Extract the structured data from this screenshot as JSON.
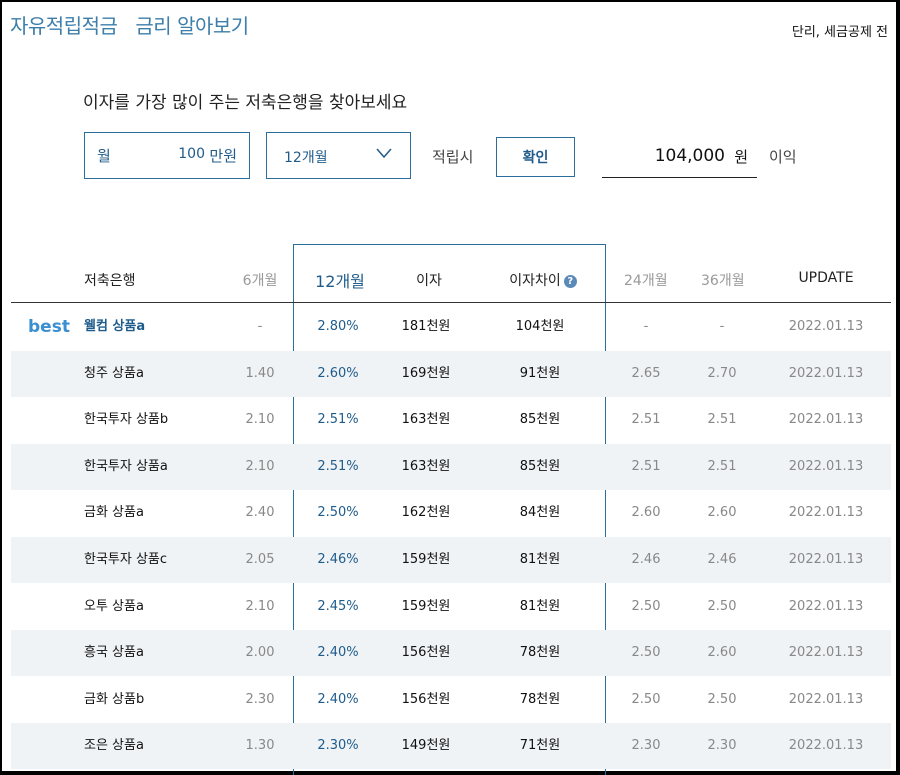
{
  "header": {
    "title": "자유적립적금",
    "subtitle": "금리 알아보기",
    "note": "단리, 세금공제 전"
  },
  "calculator": {
    "headline": "이자를 가장 많이 주는 저축은행을 찾아보세요",
    "monthly_label": "월",
    "monthly_amount": "100",
    "monthly_unit": "만원",
    "period_value": "12개월",
    "deposit_label": "적립시",
    "confirm_label": "확인",
    "result_amount": "104,000",
    "result_unit": "원",
    "interest_label": "이익"
  },
  "table": {
    "columns": {
      "bank": "저축은행",
      "m6": "6개월",
      "m12": "12개월",
      "interest": "이자",
      "diff": "이자차이",
      "m24": "24개월",
      "m36": "36개월",
      "update": "UPDATE"
    },
    "best_badge": "best",
    "rows": [
      {
        "bank": "웰컴 상품a",
        "m6": "-",
        "m12": "2.80%",
        "interest": "181천원",
        "diff": "104천원",
        "m24": "-",
        "m36": "-",
        "update": "2022.01.13"
      },
      {
        "bank": "청주 상품a",
        "m6": "1.40",
        "m12": "2.60%",
        "interest": "169천원",
        "diff": "91천원",
        "m24": "2.65",
        "m36": "2.70",
        "update": "2022.01.13"
      },
      {
        "bank": "한국투자 상품b",
        "m6": "2.10",
        "m12": "2.51%",
        "interest": "163천원",
        "diff": "85천원",
        "m24": "2.51",
        "m36": "2.51",
        "update": "2022.01.13"
      },
      {
        "bank": "한국투자 상품a",
        "m6": "2.10",
        "m12": "2.51%",
        "interest": "163천원",
        "diff": "85천원",
        "m24": "2.51",
        "m36": "2.51",
        "update": "2022.01.13"
      },
      {
        "bank": "금화 상품a",
        "m6": "2.40",
        "m12": "2.50%",
        "interest": "162천원",
        "diff": "84천원",
        "m24": "2.60",
        "m36": "2.60",
        "update": "2022.01.13"
      },
      {
        "bank": "한국투자 상품c",
        "m6": "2.05",
        "m12": "2.46%",
        "interest": "159천원",
        "diff": "81천원",
        "m24": "2.46",
        "m36": "2.46",
        "update": "2022.01.13"
      },
      {
        "bank": "오투 상품a",
        "m6": "2.10",
        "m12": "2.45%",
        "interest": "159천원",
        "diff": "81천원",
        "m24": "2.50",
        "m36": "2.50",
        "update": "2022.01.13"
      },
      {
        "bank": "흥국 상품a",
        "m6": "2.00",
        "m12": "2.40%",
        "interest": "156천원",
        "diff": "78천원",
        "m24": "2.50",
        "m36": "2.60",
        "update": "2022.01.13"
      },
      {
        "bank": "금화 상품b",
        "m6": "2.30",
        "m12": "2.40%",
        "interest": "156천원",
        "diff": "78천원",
        "m24": "2.50",
        "m36": "2.50",
        "update": "2022.01.13"
      },
      {
        "bank": "조은 상품a",
        "m6": "1.30",
        "m12": "2.30%",
        "interest": "149천원",
        "diff": "71천원",
        "m24": "2.30",
        "m36": "2.30",
        "update": "2022.01.13"
      }
    ]
  }
}
